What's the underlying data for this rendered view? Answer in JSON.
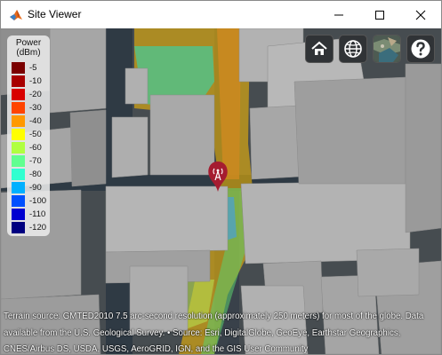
{
  "window": {
    "title": "Site Viewer",
    "controls": [
      "minimize-icon",
      "maximize-icon",
      "close-icon"
    ]
  },
  "toolbar": {
    "buttons": [
      {
        "name": "home-button",
        "icon": "home-icon"
      },
      {
        "name": "globe-button",
        "icon": "globe-icon"
      },
      {
        "name": "basemap-button",
        "icon": "basemap-thumbnail-icon"
      },
      {
        "name": "help-button",
        "icon": "question-mark-icon"
      }
    ]
  },
  "legend": {
    "title_line1": "Power",
    "title_line2": "(dBm)",
    "entries": [
      {
        "label": "-5",
        "color": "#7a0000"
      },
      {
        "label": "-10",
        "color": "#a80000"
      },
      {
        "label": "-20",
        "color": "#d80000"
      },
      {
        "label": "-30",
        "color": "#ff4400"
      },
      {
        "label": "-40",
        "color": "#ff9900"
      },
      {
        "label": "-50",
        "color": "#ffff00"
      },
      {
        "label": "-60",
        "color": "#b0ff40"
      },
      {
        "label": "-70",
        "color": "#60ff90"
      },
      {
        "label": "-80",
        "color": "#30ffd0"
      },
      {
        "label": "-90",
        "color": "#00b0ff"
      },
      {
        "label": "-100",
        "color": "#0050ff"
      },
      {
        "label": "-110",
        "color": "#0000d0"
      },
      {
        "label": "-120",
        "color": "#000080"
      }
    ]
  },
  "map": {
    "marker_icon": "cell-tower-icon",
    "marker_color": "#a51c30"
  },
  "credits": {
    "text": "Terrain source: GMTED2010 7.5 arc-second resolution (approximately 250 meters) for most of the globe. Data available from the U.S. Geological Survey. • Source: Esri, DigitalGlobe, GeoEye, Earthstar Geographics, CNES/Airbus DS, USDA, USGS, AeroGRID, IGN, and the GIS User Community"
  }
}
